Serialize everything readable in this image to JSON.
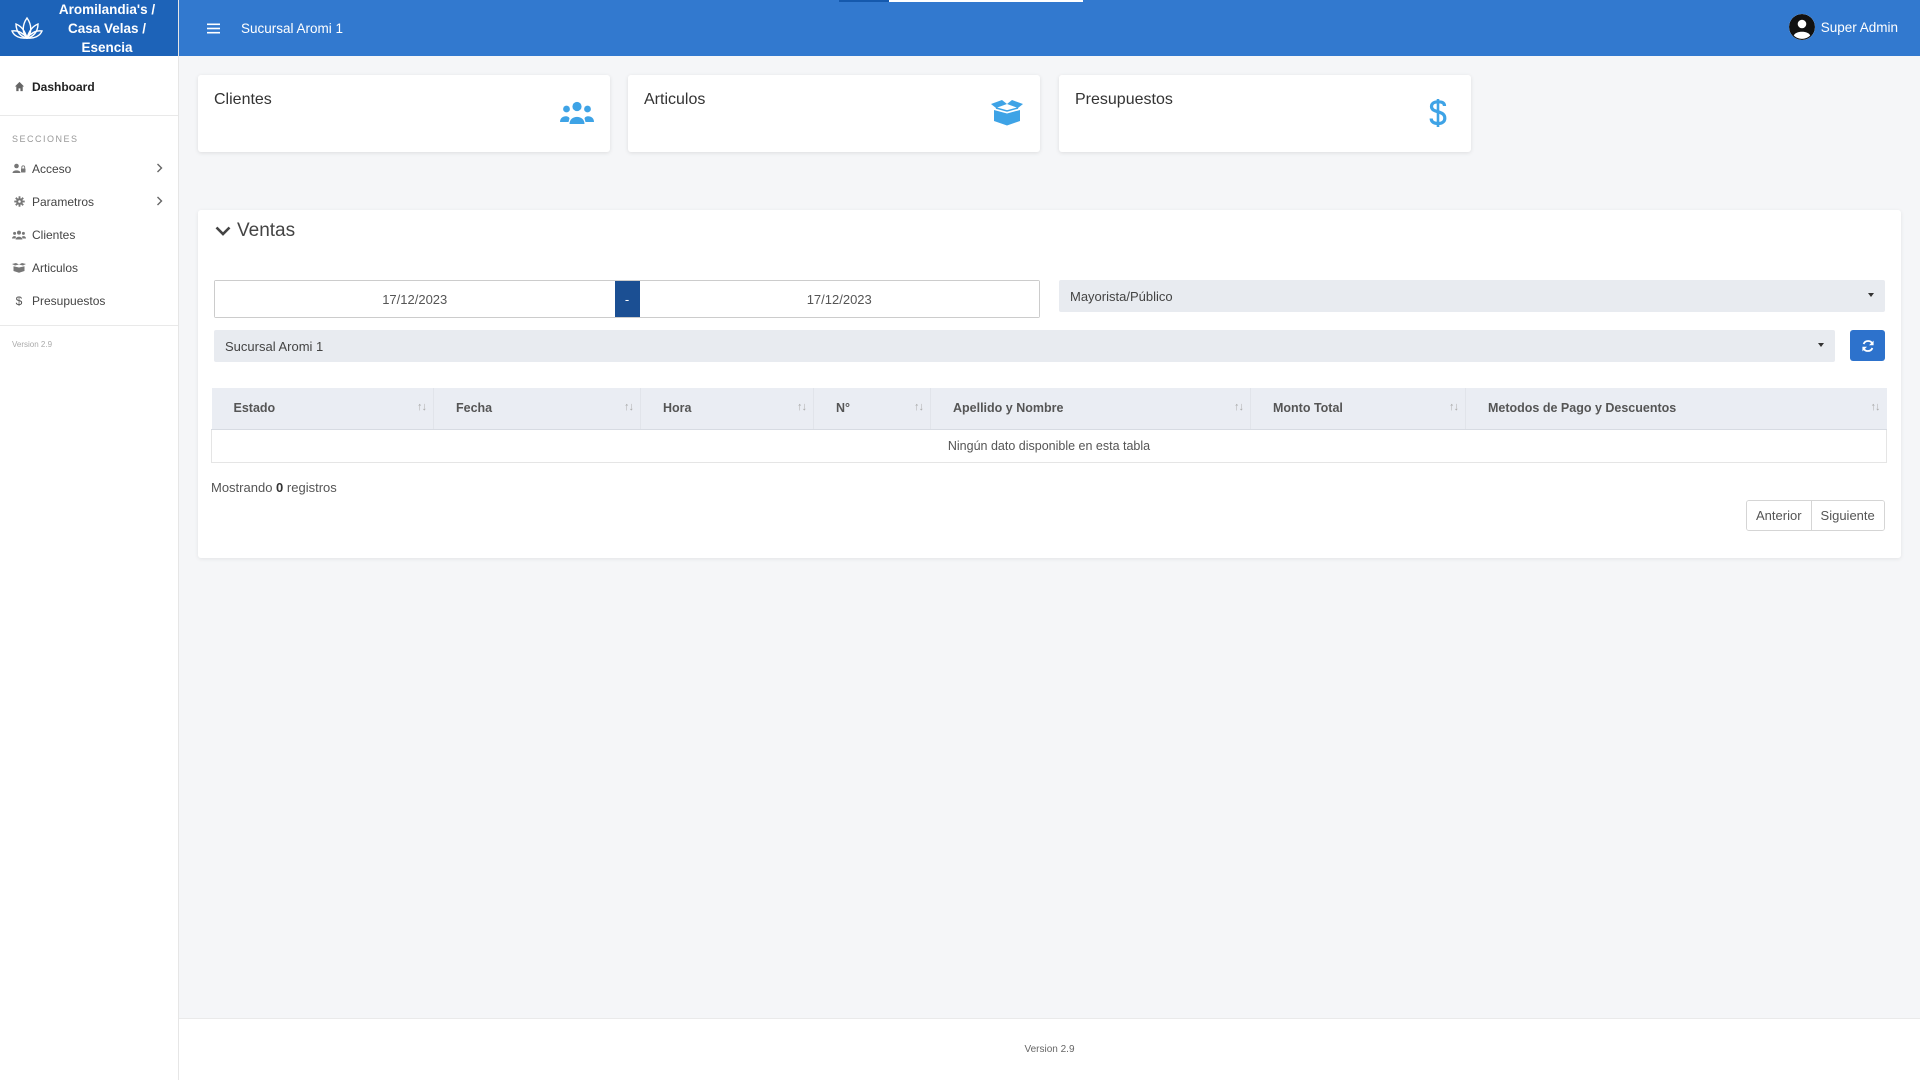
{
  "brand": {
    "name": "Aromilandia's / Casa Velas / Esencia",
    "logo_icon": "lotus-logo-icon"
  },
  "sidebar": {
    "dashboard": {
      "label": "Dashboard",
      "icon": "home-icon"
    },
    "section_title": "SECCIONES",
    "items": [
      {
        "label": "Acceso",
        "icon": "users-lock-icon",
        "has_submenu": true
      },
      {
        "label": "Parametros",
        "icon": "gear-icon",
        "has_submenu": true
      },
      {
        "label": "Clientes",
        "icon": "users-icon",
        "has_submenu": false
      },
      {
        "label": "Articulos",
        "icon": "boxes-icon",
        "has_submenu": false
      },
      {
        "label": "Presupuestos",
        "icon": "dollar-icon",
        "has_submenu": false
      }
    ],
    "version": "Version 2.9"
  },
  "topbar": {
    "branch": "Sucursal Aromi 1",
    "user": "Super Admin",
    "bg_color": "#3279cf"
  },
  "cards": [
    {
      "title": "Clientes",
      "icon": "users-icon"
    },
    {
      "title": "Articulos",
      "icon": "box-open-icon"
    },
    {
      "title": "Presupuestos",
      "icon": "dollar-icon"
    }
  ],
  "ventas": {
    "title": "Ventas",
    "date_from": "17/12/2023",
    "date_separator": "-",
    "date_to": "17/12/2023",
    "tipo_select": "Mayorista/Público",
    "sucursal_select": "Sucursal Aromi 1",
    "table": {
      "columns": [
        "Estado",
        "Fecha",
        "Hora",
        "N°",
        "Apellido y Nombre",
        "Monto Total",
        "Metodos de Pago y Descuentos"
      ],
      "empty_message": "Ningún dato disponible en esta tabla"
    },
    "showing_prefix": "Mostrando",
    "showing_count": "0",
    "showing_suffix": "registros",
    "pagination": {
      "prev": "Anterior",
      "next": "Siguiente"
    }
  },
  "footer": {
    "version": "Version 2.9"
  },
  "colors": {
    "accent": "#3279cf",
    "brand_bg": "#1d63b8",
    "icon_blue": "#3ea3e6",
    "date_sep": "#1b4f93"
  }
}
